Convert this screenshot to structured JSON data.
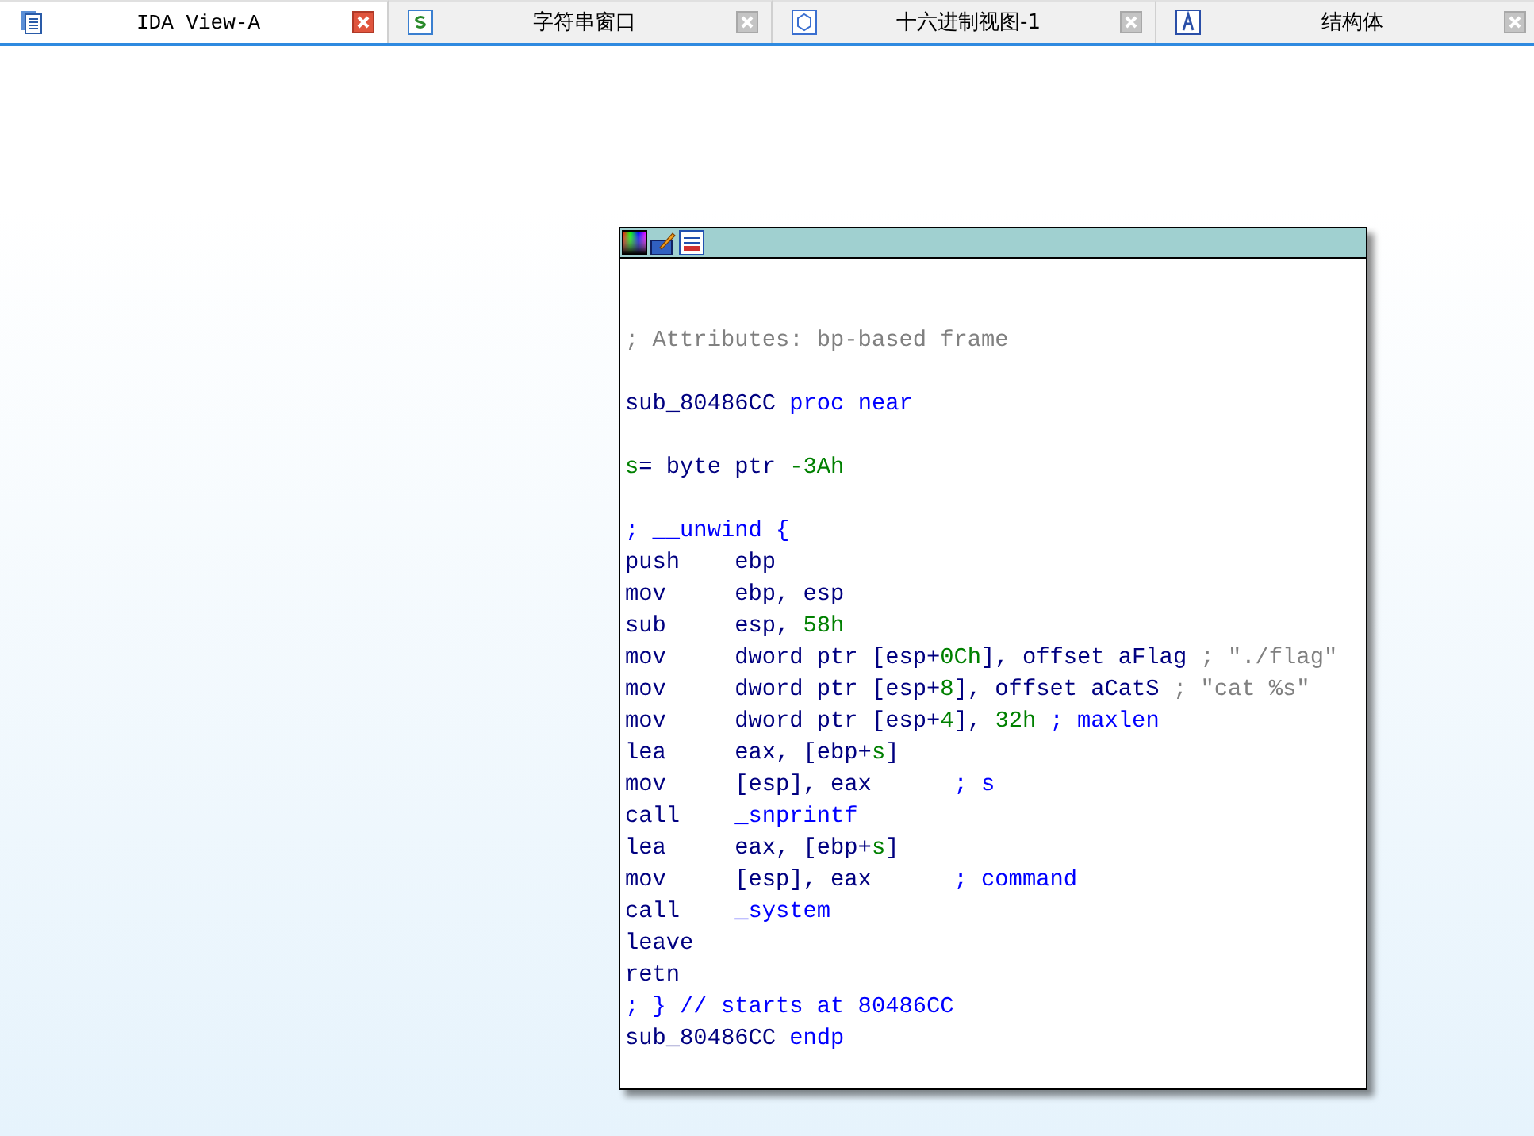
{
  "tabs": [
    {
      "label": "IDA View-A",
      "kind": "listing",
      "selected": true
    },
    {
      "label": "字符串窗口",
      "kind": "strings",
      "selected": false
    },
    {
      "label": "十六进制视图-1",
      "kind": "hex",
      "selected": false
    },
    {
      "label": "结构体",
      "kind": "struct",
      "selected": false
    }
  ],
  "graph_node": {
    "lines": [
      {
        "kind": "blank"
      },
      {
        "kind": "blank"
      },
      {
        "kind": "code",
        "segments": [
          {
            "kind": "comment",
            "text": "; Attributes: bp-based frame"
          }
        ]
      },
      {
        "kind": "blank"
      },
      {
        "kind": "code",
        "segments": [
          {
            "kind": "plain",
            "text": "sub_80486CC "
          },
          {
            "kind": "keyword",
            "text": "proc near"
          }
        ]
      },
      {
        "kind": "blank"
      },
      {
        "kind": "code",
        "segments": [
          {
            "kind": "var",
            "text": "s"
          },
          {
            "kind": "plain",
            "text": "= byte ptr "
          },
          {
            "kind": "number",
            "text": "-3Ah"
          }
        ]
      },
      {
        "kind": "blank"
      },
      {
        "kind": "code",
        "segments": [
          {
            "kind": "keyword",
            "text": "; __unwind {"
          }
        ]
      },
      {
        "kind": "code",
        "segments": [
          {
            "kind": "plain",
            "text": "push    ebp"
          }
        ]
      },
      {
        "kind": "code",
        "segments": [
          {
            "kind": "plain",
            "text": "mov     ebp, esp"
          }
        ]
      },
      {
        "kind": "code",
        "segments": [
          {
            "kind": "plain",
            "text": "sub     esp, "
          },
          {
            "kind": "number",
            "text": "58h"
          }
        ]
      },
      {
        "kind": "code",
        "segments": [
          {
            "kind": "plain",
            "text": "mov     dword ptr [esp+"
          },
          {
            "kind": "number",
            "text": "0Ch"
          },
          {
            "kind": "plain",
            "text": "], offset aFlag "
          },
          {
            "kind": "comment",
            "text": "; \"./flag\""
          }
        ]
      },
      {
        "kind": "code",
        "segments": [
          {
            "kind": "plain",
            "text": "mov     dword ptr [esp+"
          },
          {
            "kind": "number",
            "text": "8"
          },
          {
            "kind": "plain",
            "text": "], offset aCatS "
          },
          {
            "kind": "comment",
            "text": "; \"cat %s\""
          }
        ]
      },
      {
        "kind": "code",
        "segments": [
          {
            "kind": "plain",
            "text": "mov     dword ptr [esp+"
          },
          {
            "kind": "number",
            "text": "4"
          },
          {
            "kind": "plain",
            "text": "], "
          },
          {
            "kind": "number",
            "text": "32h"
          },
          {
            "kind": "keyword",
            "text": " ; maxlen"
          }
        ]
      },
      {
        "kind": "code",
        "segments": [
          {
            "kind": "plain",
            "text": "lea     eax, [ebp+"
          },
          {
            "kind": "var",
            "text": "s"
          },
          {
            "kind": "plain",
            "text": "]"
          }
        ]
      },
      {
        "kind": "code",
        "segments": [
          {
            "kind": "plain",
            "text": "mov     [esp], eax      "
          },
          {
            "kind": "keyword",
            "text": "; s"
          }
        ]
      },
      {
        "kind": "code",
        "segments": [
          {
            "kind": "plain",
            "text": "call    "
          },
          {
            "kind": "keyword",
            "text": "_snprintf"
          }
        ]
      },
      {
        "kind": "code",
        "segments": [
          {
            "kind": "plain",
            "text": "lea     eax, [ebp+"
          },
          {
            "kind": "var",
            "text": "s"
          },
          {
            "kind": "plain",
            "text": "]"
          }
        ]
      },
      {
        "kind": "code",
        "segments": [
          {
            "kind": "plain",
            "text": "mov     [esp], eax      "
          },
          {
            "kind": "keyword",
            "text": "; command"
          }
        ]
      },
      {
        "kind": "code",
        "segments": [
          {
            "kind": "plain",
            "text": "call    "
          },
          {
            "kind": "keyword",
            "text": "_system"
          }
        ]
      },
      {
        "kind": "code",
        "segments": [
          {
            "kind": "plain",
            "text": "leave"
          }
        ]
      },
      {
        "kind": "code",
        "segments": [
          {
            "kind": "plain",
            "text": "retn"
          }
        ]
      },
      {
        "kind": "code",
        "segments": [
          {
            "kind": "keyword",
            "text": "; } // starts at 80486CC"
          }
        ]
      },
      {
        "kind": "code",
        "segments": [
          {
            "kind": "plain",
            "text": "sub_80486CC "
          },
          {
            "kind": "keyword",
            "text": "endp"
          }
        ]
      }
    ]
  }
}
